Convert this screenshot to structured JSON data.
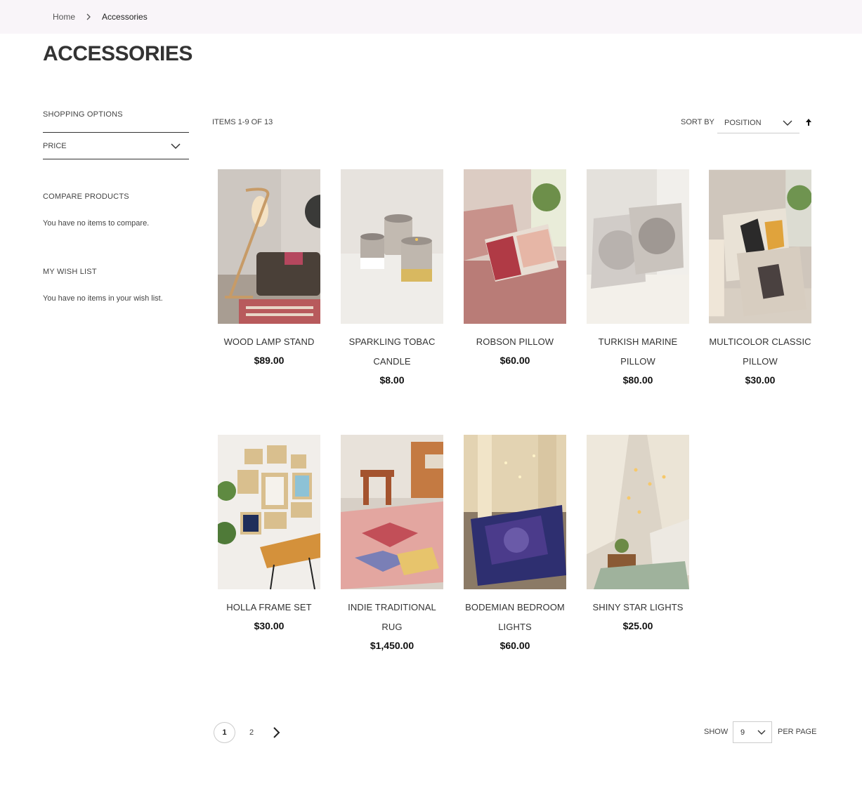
{
  "breadcrumb": {
    "home": "Home",
    "current": "Accessories"
  },
  "page_title": "ACCESSORIES",
  "sidebar": {
    "shopping_options": "SHOPPING OPTIONS",
    "price_filter": "PRICE",
    "compare_title": "COMPARE PRODUCTS",
    "compare_text": "You have no items to compare.",
    "wishlist_title": "MY WISH LIST",
    "wishlist_text": "You have no items in your wish list."
  },
  "toolbar": {
    "count": "ITEMS 1-9 OF 13",
    "sort_label": "SORT BY",
    "sort_value": "POSITION"
  },
  "products": [
    {
      "name": "WOOD LAMP STAND",
      "price": "$89.00"
    },
    {
      "name": "SPARKLING TOBAC CANDLE",
      "price": "$8.00"
    },
    {
      "name": "ROBSON PILLOW",
      "price": "$60.00"
    },
    {
      "name": "TURKISH MARINE PILLOW",
      "price": "$80.00"
    },
    {
      "name": "MULTICOLOR CLASSIC PILLOW",
      "price": "$30.00"
    },
    {
      "name": "HOLLA FRAME SET",
      "price": "$30.00"
    },
    {
      "name": "INDIE TRADITIONAL RUG",
      "price": "$1,450.00"
    },
    {
      "name": "BODEMIAN BEDROOM LIGHTS",
      "price": "$60.00"
    },
    {
      "name": "SHINY STAR LIGHTS",
      "price": "$25.00"
    }
  ],
  "pager": {
    "current": "1",
    "page2": "2"
  },
  "limiter": {
    "label": "SHOW",
    "value": "9",
    "suffix": "PER PAGE"
  }
}
